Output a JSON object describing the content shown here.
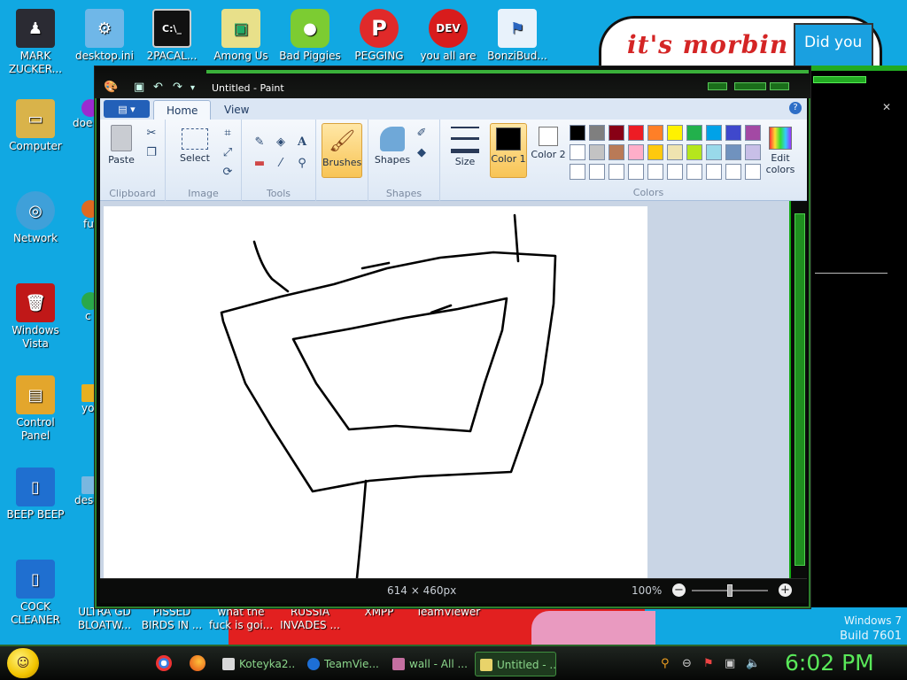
{
  "desktop": {
    "icons_top": [
      {
        "label": "MARK ZUCKER...",
        "icon": "mark-zuckerberg-icon",
        "color": "#2b2b33"
      },
      {
        "label": "desktop.ini",
        "icon": "config-file-icon",
        "color": "#6fb7e8"
      },
      {
        "label": "2PACAL...",
        "icon": "terminal-icon",
        "color": "#111111"
      },
      {
        "label": "Among Us",
        "icon": "among-us-icon",
        "color": "#e8e08a"
      },
      {
        "label": "Bad Piggies",
        "icon": "bad-piggies-icon",
        "color": "#7ccc32"
      },
      {
        "label": "PEGGING",
        "icon": "pegging-icon",
        "color": "#e02a2a"
      },
      {
        "label": "you all are",
        "icon": "dev-cpp-icon",
        "color": "#d81c1c"
      },
      {
        "label": "BonziBud...",
        "icon": "bonzibuddy-icon",
        "color": "#e8f2fb"
      }
    ],
    "icons_left": [
      {
        "label": "Computer",
        "icon": "computer-icon",
        "color": "#d9b34a"
      },
      {
        "label": "Network",
        "icon": "network-icon",
        "color": "#3fa0d9"
      },
      {
        "label": "Windows Vista",
        "icon": "recycle-bin-icon",
        "color": "#c01818"
      },
      {
        "label": "Control Panel",
        "icon": "control-panel-icon",
        "color": "#e3a62c"
      },
      {
        "label": "BEEP BEEP",
        "icon": "file-icon",
        "color": "#1f6fd0"
      },
      {
        "label": "COCK CLEANER",
        "icon": "file-icon",
        "color": "#1f6fd0"
      }
    ],
    "icons_col2": [
      {
        "label": "doe",
        "icon": "app-icon",
        "color": "#9a2bd0"
      },
      {
        "label": "fu",
        "icon": "app-icon",
        "color": "#e06a20"
      },
      {
        "label": "c",
        "icon": "app-icon",
        "color": "#2aa84a"
      },
      {
        "label": "yo",
        "icon": "app-icon",
        "color": "#e8b020"
      },
      {
        "label": "des",
        "icon": "app-icon",
        "color": "#7ab7e0"
      }
    ],
    "icons_bottom": [
      {
        "label": "ULTRA GD BLOATW...",
        "icon": "file-icon"
      },
      {
        "label": "PISSED BIRDS IN ...",
        "icon": "file-icon"
      },
      {
        "label": "what the fuck is goi...",
        "icon": "file-icon"
      },
      {
        "label": "RUSSIA INVADES ...",
        "icon": "file-icon"
      },
      {
        "label": "XMPP",
        "icon": "xmpp-icon"
      },
      {
        "label": "TeamViewer",
        "icon": "teamviewer-icon"
      }
    ],
    "wallpaper_text": "it's morbin t",
    "wallpaper_did": "Did you",
    "wallpaper_excl": "!!!",
    "watermark_os": "Windows 7",
    "watermark_build": "Build 7601"
  },
  "paint": {
    "title": "Untitled - Paint",
    "app_menu_label": "▤ ▾",
    "tabs": [
      {
        "label": "Home",
        "active": true
      },
      {
        "label": "View",
        "active": false
      }
    ],
    "help_label": "?",
    "groups": {
      "clipboard": {
        "label": "Clipboard",
        "paste": "Paste"
      },
      "image": {
        "label": "Image",
        "select": "Select"
      },
      "tools": {
        "label": "Tools"
      },
      "brushes": {
        "label": "Brushes"
      },
      "shapes": {
        "label": "Shapes",
        "button": "Shapes"
      },
      "size": {
        "label": "Size"
      },
      "color1": {
        "label": "Color 1",
        "value": "#000000"
      },
      "color2": {
        "label": "Color 2",
        "value": "#ffffff"
      },
      "colors": {
        "label": "Colors",
        "edit": "Edit colors"
      }
    },
    "palette_row1": [
      "#000000",
      "#7f7f7f",
      "#880015",
      "#ed1c24",
      "#ff7f27",
      "#fff200",
      "#22b14c",
      "#00a2e8",
      "#3f48cc",
      "#a349a4"
    ],
    "palette_row2": [
      "#ffffff",
      "#c3c3c3",
      "#b97a57",
      "#ffaec9",
      "#ffc90e",
      "#efe4b0",
      "#b5e61d",
      "#99d9ea",
      "#7092be",
      "#c8bfe7"
    ],
    "palette_row3": [
      "#ffffff",
      "#ffffff",
      "#ffffff",
      "#ffffff",
      "#ffffff",
      "#ffffff",
      "#ffffff",
      "#ffffff",
      "#ffffff",
      "#ffffff"
    ],
    "status": {
      "canvas_size": "614 × 460px",
      "zoom": "100%"
    }
  },
  "taskbar": {
    "tasks": [
      {
        "label": "Koteyka2...",
        "color": "#d8d8d8",
        "active": false
      },
      {
        "label": "TeamVie...",
        "color": "#1d6fd6",
        "active": false
      },
      {
        "label": "wall - All ...",
        "color": "#c46fa0",
        "active": false
      },
      {
        "label": "Untitled - ...",
        "color": "#e8d36a",
        "active": true
      }
    ],
    "clock": "6:02 PM"
  }
}
